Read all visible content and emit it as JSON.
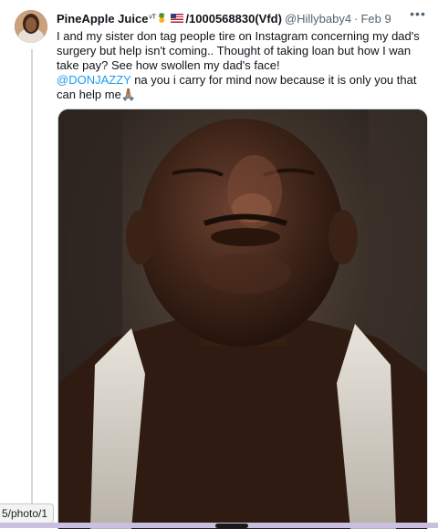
{
  "tweet": {
    "display_name": "PineApple Juice",
    "name_suffix": "/1000568830(Vfd)",
    "handle": "@Hillybaby4",
    "separator": "·",
    "date": "Feb 9",
    "more_icon": "more-horizontal-icon",
    "text_line_1": "I and my sister don tag people tire on Instagram concerning my dad's surgery but help isn't coming.. Thought of taking loan but  how I wan take pay? See how swollen my dad's face!",
    "mention": "@DONJAZZY",
    "text_line_2": " na you i carry for mind now because it is only you that can help me🙏🏽"
  },
  "status_bar": {
    "url": "5/photo/1"
  }
}
